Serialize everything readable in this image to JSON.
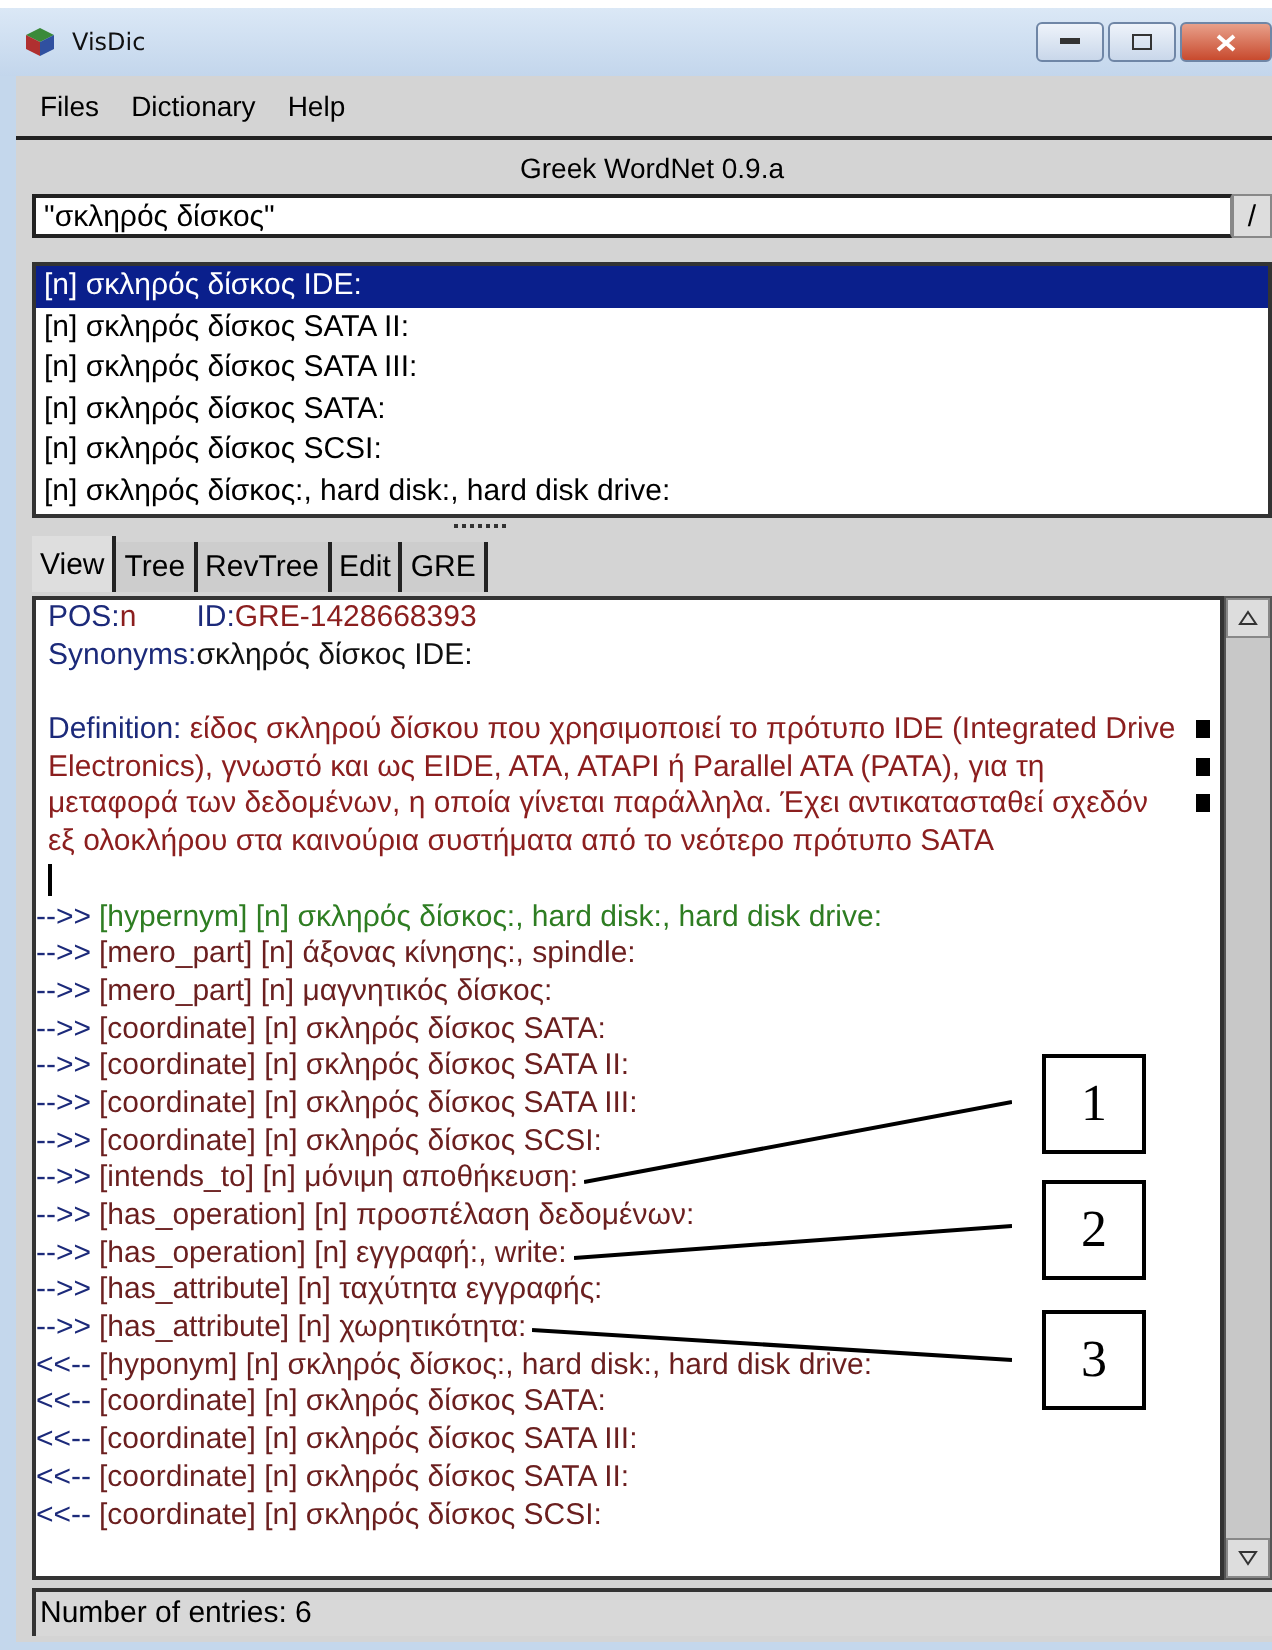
{
  "window": {
    "title": "VisDic"
  },
  "menu": [
    "Files",
    "Dictionary",
    "Help"
  ],
  "dictionary_title": "Greek WordNet 0.9.a",
  "search": {
    "value": "\"σκληρός δίσκος\"",
    "button": "/"
  },
  "results": [
    {
      "label": "[n] σκληρός δίσκος IDE:",
      "selected": true
    },
    {
      "label": "[n] σκληρός δίσκος SATA II:",
      "selected": false
    },
    {
      "label": "[n] σκληρός δίσκος SATA III:",
      "selected": false
    },
    {
      "label": "[n] σκληρός δίσκος SATA:",
      "selected": false
    },
    {
      "label": "[n] σκληρός δίσκος SCSI:",
      "selected": false
    },
    {
      "label": "[n] σκληρός δίσκος:, hard disk:, hard disk drive:",
      "selected": false
    }
  ],
  "tabs": [
    {
      "label": "View",
      "selected": true
    },
    {
      "label": "Tree",
      "selected": false
    },
    {
      "label": "RevTree",
      "selected": false
    },
    {
      "label": "Edit",
      "selected": false
    },
    {
      "label": "GRE",
      "selected": false
    }
  ],
  "entry": {
    "pos_label": "POS:",
    "pos": "n",
    "id_label": "ID:",
    "id": "GRE-1428668393",
    "synonyms_label": "Synonyms:",
    "synonyms": "σκληρός δίσκος IDE:",
    "definition_label": "Definition:",
    "definition_lines": [
      "είδος σκληρού δίσκου που χρησιμοποιεί το πρότυπο IDE (Integrated Drive",
      "Electronics), γνωστό και ως EIDE, ATA, ATAPI ή Parallel ATA (PATA), για τη",
      "μεταφορά των δεδομένων, η οποία γίνεται παράλληλα. Έχει αντικατασταθεί σχεδόν",
      "εξ ολοκλήρου στα καινούρια συστήματα από το νεότερο πρότυπο SATA"
    ]
  },
  "relations": [
    {
      "arrow": "-->>",
      "text": "[hypernym] [n] σκληρός δίσκος:, hard disk:, hard disk drive:",
      "color": "#2e7d22"
    },
    {
      "arrow": "-->>",
      "text": "[mero_part] [n] άξονας κίνησης:, spindle:",
      "color": "#6b1f1f"
    },
    {
      "arrow": "-->>",
      "text": "[mero_part] [n] μαγνητικός δίσκος:",
      "color": "#6b1f1f"
    },
    {
      "arrow": "-->>",
      "text": "[coordinate] [n] σκληρός δίσκος SATA:",
      "color": "#6b1f1f"
    },
    {
      "arrow": "-->>",
      "text": "[coordinate] [n] σκληρός δίσκος SATA II:",
      "color": "#6b1f1f"
    },
    {
      "arrow": "-->>",
      "text": "[coordinate] [n] σκληρός δίσκος SATA III:",
      "color": "#6b1f1f"
    },
    {
      "arrow": "-->>",
      "text": "[coordinate] [n] σκληρός δίσκος SCSI:",
      "color": "#6b1f1f"
    },
    {
      "arrow": "-->>",
      "text": "[intends_to] [n] μόνιμη αποθήκευση:",
      "color": "#6b1f1f"
    },
    {
      "arrow": "-->>",
      "text": "[has_operation] [n] προσπέλαση δεδομένων:",
      "color": "#6b1f1f"
    },
    {
      "arrow": "-->>",
      "text": "[has_operation] [n] εγγραφή:, write:",
      "color": "#6b1f1f"
    },
    {
      "arrow": "-->>",
      "text": "[has_attribute] [n] ταχύτητα εγγραφής:",
      "color": "#6b1f1f"
    },
    {
      "arrow": "-->>",
      "text": "[has_attribute] [n] χωρητικότητα:",
      "color": "#6b1f1f"
    },
    {
      "arrow": "<<--",
      "text": "[hyponym] [n] σκληρός δίσκος:, hard disk:, hard disk drive:",
      "color": "#6b1f1f"
    },
    {
      "arrow": "<<--",
      "text": "[coordinate] [n] σκληρός δίσκος SATA:",
      "color": "#6b1f1f"
    },
    {
      "arrow": "<<--",
      "text": "[coordinate] [n] σκληρός δίσκος SATA III:",
      "color": "#6b1f1f"
    },
    {
      "arrow": "<<--",
      "text": "[coordinate] [n] σκληρός δίσκος SATA II:",
      "color": "#6b1f1f"
    },
    {
      "arrow": "<<--",
      "text": "[coordinate] [n] σκληρός δίσκος SCSI:",
      "color": "#6b1f1f"
    }
  ],
  "callouts": [
    {
      "label": "1"
    },
    {
      "label": "2"
    },
    {
      "label": "3"
    }
  ],
  "status_bar": "Number of entries: 6"
}
